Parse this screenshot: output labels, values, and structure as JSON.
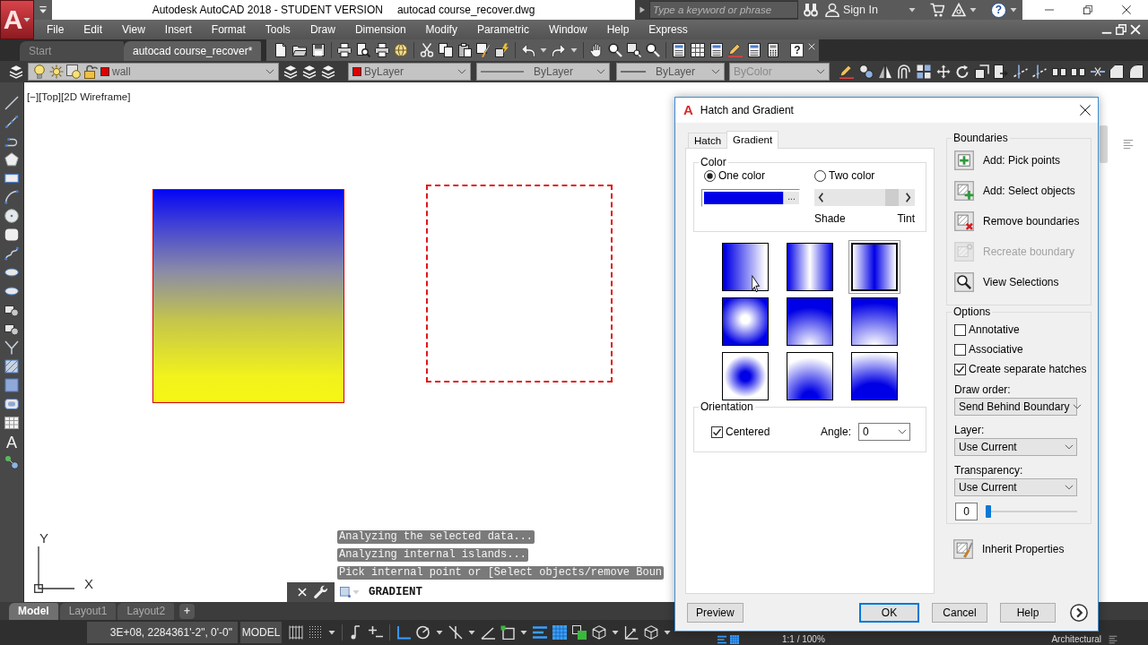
{
  "title_bar": {
    "app_button": "A",
    "title": "Autodesk AutoCAD 2018 - STUDENT VERSION",
    "file": "autocad course_recover.dwg",
    "search": {
      "placeholder": "Type a keyword or phrase"
    },
    "sign_in": "Sign In",
    "help": "?"
  },
  "menu_bar": [
    "File",
    "Edit",
    "View",
    "Insert",
    "Format",
    "Tools",
    "Draw",
    "Dimension",
    "Modify",
    "Parametric",
    "Window",
    "Help",
    "Express"
  ],
  "file_tabs": [
    {
      "label": "Start",
      "selected": false
    },
    {
      "label": "autocad course_recover*",
      "selected": true
    }
  ],
  "standard_toolbar": {
    "help": "?"
  },
  "properties_toolbar": {
    "layer": {
      "value": "wall",
      "color": "#dd0000"
    },
    "color": {
      "value": "ByLayer",
      "color": "#dd0000"
    },
    "linetype": "ByLayer",
    "lineweight": "ByLayer",
    "plot_style": "ByColor"
  },
  "draw_toolbar": {
    "text_tool": "A"
  },
  "viewport": {
    "label": "[−][Top][2D Wireframe]",
    "ucs": {
      "y": "Y",
      "x": "X"
    }
  },
  "command_history": [
    "Analyzing the selected data...",
    "Analyzing internal islands...",
    "Pick internal point or [Select objects/remove Boun"
  ],
  "command_line": {
    "value": "GRADIENT"
  },
  "layout_tabs": [
    {
      "label": "Model",
      "selected": true
    },
    {
      "label": "Layout1",
      "selected": false
    },
    {
      "label": "Layout2",
      "selected": false
    }
  ],
  "add_layout": "+",
  "status_bar": {
    "coordinates": "3E+08, 2284361'-2\", 0'-0\"",
    "space": "MODEL",
    "scale": "1:1 / 100%",
    "units": "Architectural"
  },
  "dialog": {
    "logo": "A",
    "title": "Hatch and Gradient",
    "tabs": [
      {
        "label": "Hatch",
        "selected": false
      },
      {
        "label": "Gradient",
        "selected": true
      }
    ],
    "color_group": {
      "label": "Color",
      "modes": [
        {
          "label": "One color",
          "selected": true
        },
        {
          "label": "Two color",
          "selected": false
        }
      ],
      "color": "#0000e6",
      "browse": "...",
      "shade": {
        "level": 0.95
      },
      "shade_label": "Shade",
      "tint_label": "Tint"
    },
    "patterns": [
      {
        "kind": "linear",
        "selected": false
      },
      {
        "kind": "cylinder",
        "selected": false
      },
      {
        "kind": "invcylinder",
        "selected": true
      },
      {
        "kind": "spherical",
        "selected": false
      },
      {
        "kind": "hemispherical",
        "selected": false
      },
      {
        "kind": "curved",
        "selected": false
      },
      {
        "kind": "invspherical",
        "selected": false
      },
      {
        "kind": "invhemispherical",
        "selected": false
      },
      {
        "kind": "invcurved",
        "selected": false
      }
    ],
    "orientation": {
      "label": "Orientation",
      "centered": {
        "label": "Centered",
        "checked": true
      },
      "angle_label": "Angle:",
      "angle": "0"
    },
    "boundaries": {
      "label": "Boundaries",
      "buttons": [
        {
          "kind": "pick",
          "label": "Add: Pick points",
          "disabled": false
        },
        {
          "kind": "select",
          "label": "Add: Select objects",
          "disabled": false
        },
        {
          "kind": "remove",
          "label": "Remove boundaries",
          "disabled": false
        },
        {
          "kind": "recreate",
          "label": "Recreate boundary",
          "disabled": true
        },
        {
          "kind": "view",
          "label": "View Selections",
          "disabled": false
        }
      ]
    },
    "options": {
      "label": "Options",
      "checkboxes": [
        {
          "label": "Annotative",
          "checked": false
        },
        {
          "label": "Associative",
          "checked": false
        },
        {
          "label": "Create separate hatches",
          "checked": true
        }
      ],
      "draw_order": {
        "label": "Draw order:",
        "value": "Send Behind Boundary"
      },
      "layer": {
        "label": "Layer:",
        "value": "Use Current"
      },
      "transparency": {
        "label": "Transparency:",
        "value": "Use Current",
        "amount": "0",
        "level": 0
      }
    },
    "inherit": "Inherit Properties",
    "buttons": [
      {
        "label": "Preview",
        "default": false
      },
      {
        "label": "OK",
        "default": true
      },
      {
        "label": "Cancel",
        "default": false
      },
      {
        "label": "Help",
        "default": false
      }
    ]
  }
}
